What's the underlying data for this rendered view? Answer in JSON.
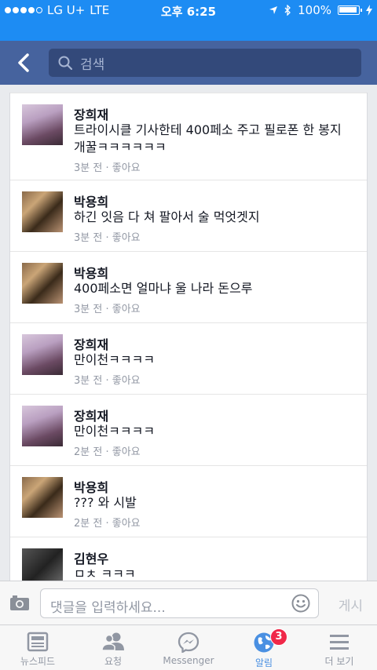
{
  "status_bar": {
    "carrier": "LG U+",
    "network": "LTE",
    "time": "오후 6:25",
    "battery": "100%"
  },
  "search": {
    "placeholder": "검색"
  },
  "comments": [
    {
      "name": "장희재",
      "text": "트라이시클 기사한테 400페소 주고 필로폰 한 봉지 개꿀ㅋㅋㅋㅋㅋㅋ",
      "time": "3분 전",
      "like": "좋아요",
      "avatar": "girl-photo"
    },
    {
      "name": "박용희",
      "text": "하긴 잇음 다 쳐 팔아서 술 먹엇겟지",
      "time": "3분 전",
      "like": "좋아요",
      "avatar": "man-photo"
    },
    {
      "name": "박용희",
      "text": "400페소면 얼마냐 울 나라 돈으루",
      "time": "3분 전",
      "like": "좋아요",
      "avatar": "man-photo"
    },
    {
      "name": "장희재",
      "text": "만이천ㅋㅋㅋㅋ",
      "time": "3분 전",
      "like": "좋아요",
      "avatar": "girl-photo"
    },
    {
      "name": "장희재",
      "text": "만이천ㅋㅋㅋㅋ",
      "time": "2분 전",
      "like": "좋아요",
      "avatar": "girl-photo"
    },
    {
      "name": "박용희",
      "text": "??? 와 시발",
      "time": "2분 전",
      "like": "좋아요",
      "avatar": "man-photo"
    },
    {
      "name": "김현우",
      "text": "ㅁㅊ ㅋㅋㅋ",
      "time": "",
      "like": "",
      "avatar": "dark-photo"
    }
  ],
  "comment_input": {
    "placeholder": "댓글을 입력하세요...",
    "post_label": "게시"
  },
  "tabs": [
    {
      "label": "뉴스피드",
      "icon": "newsfeed-icon"
    },
    {
      "label": "요청",
      "icon": "friend-requests-icon"
    },
    {
      "label": "Messenger",
      "icon": "messenger-icon"
    },
    {
      "label": "알림",
      "icon": "globe-icon",
      "badge": "3",
      "active": true
    },
    {
      "label": "더 보기",
      "icon": "menu-icon"
    }
  ],
  "colors": {
    "status_bar": "#1d8cf3",
    "header": "#46639e",
    "search_box": "#33497a",
    "badge": "#f02849",
    "active_tab": "#4a90e2"
  }
}
